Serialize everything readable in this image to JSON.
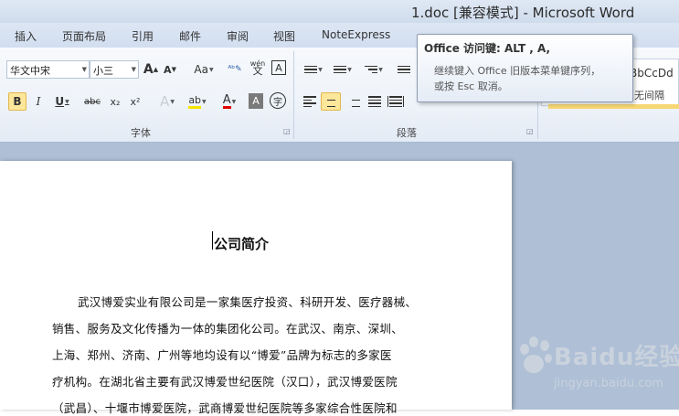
{
  "window": {
    "title": "1.doc [兼容模式] - Microsoft Word"
  },
  "tabs": [
    "插入",
    "页面布局",
    "引用",
    "邮件",
    "审阅",
    "视图",
    "NoteExpress"
  ],
  "font_group": {
    "label": "字体",
    "font_name": "华文中宋",
    "font_size": "小三",
    "grow_font": "A",
    "shrink_font": "A",
    "change_case": "Aa",
    "phonetic": "wén",
    "char_border": "A",
    "bold": "B",
    "italic": "I",
    "underline": "U",
    "strikethrough": "abc",
    "subscript": "x₂",
    "superscript": "x²",
    "text_effects": "A",
    "highlight": "ab",
    "font_color": "A",
    "char_shading": "A",
    "enclose": "字"
  },
  "paragraph_group": {
    "label": "段落"
  },
  "styles_group": {
    "preview": "BbCcDd",
    "name": "无间隔"
  },
  "tooltip": {
    "title": "Office 访问键: ALT , A,",
    "line1": "继续键入 Office 旧版本菜单键序列，",
    "line2": "或按 Esc 取消。"
  },
  "document": {
    "title": "公司简介",
    "lines": [
      "武汉博爱实业有限公司是一家集医疗投资、科研开发、医疗器械、",
      "销售、服务及文化传播为一体的集团化公司。在武汉、南京、深圳、",
      "上海、郑州、济南、广州等地均设有以“博爱”品牌为标志的多家医",
      "疗机构。在湖北省主要有武汉博爱世纪医院（汉口），武汉博爱医院",
      "（武昌）、十堰市博爱医院，武商博爱世纪医院等多家综合性医院和"
    ]
  },
  "watermark": {
    "text": "Baidu经验",
    "sub": "jingyan.baidu.com"
  }
}
